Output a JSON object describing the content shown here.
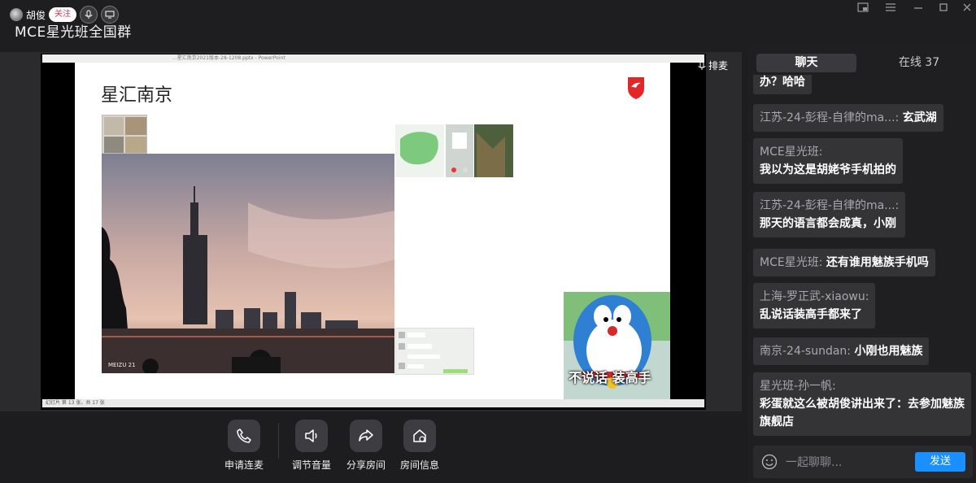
{
  "window": {
    "title": "MCE星光班全国群",
    "controls": [
      "picture-in-picture-icon",
      "menu-icon",
      "minimize-icon",
      "maximize-icon",
      "close-icon"
    ]
  },
  "stage": {
    "host_name": "胡俊",
    "follow_label": "关注",
    "queue_label": "排麦",
    "ppt_title": "...星汇南京2021版本-28-1208.pptx - PowerPoint",
    "status_text": "幻灯片 第 13 张，共 17 张",
    "slide_title": "星汇南京",
    "photo_watermark": "MEIZU 21",
    "meme_caption": "不说话 装高手"
  },
  "controls": [
    {
      "label": "申请连麦",
      "icon": "phone-icon"
    },
    {
      "label": "调节音量",
      "icon": "volume-icon"
    },
    {
      "label": "分享房间",
      "icon": "share-icon"
    },
    {
      "label": "房间信息",
      "icon": "room-info-icon"
    }
  ],
  "side": {
    "tab_chat": "聊天",
    "tab_online": "在线 37",
    "messages": [
      {
        "user": "",
        "text": "办？哈哈"
      },
      {
        "user": "江苏-24-彭程-自律的ma...:",
        "text": "玄武湖"
      },
      {
        "user": "MCE星光班:",
        "text": "我以为这是胡姥爷手机拍的"
      },
      {
        "user": "江苏-24-彭程-自律的ma...:",
        "text": "那天的语言都会成真，小刚"
      },
      {
        "user": "MCE星光班:",
        "text": "还有谁用魅族手机吗"
      },
      {
        "user": "上海-罗正武-xiaowu:",
        "text": "乱说话装高手都来了"
      },
      {
        "user": "南京-24-sundan:",
        "text": "小刚也用魅族"
      },
      {
        "user": "星光班-孙一帆:",
        "text": "彩蛋就这么被胡俊讲出来了：去参加魅族旗舰店"
      }
    ],
    "input_placeholder": "一起聊聊...",
    "send_label": "发送"
  }
}
